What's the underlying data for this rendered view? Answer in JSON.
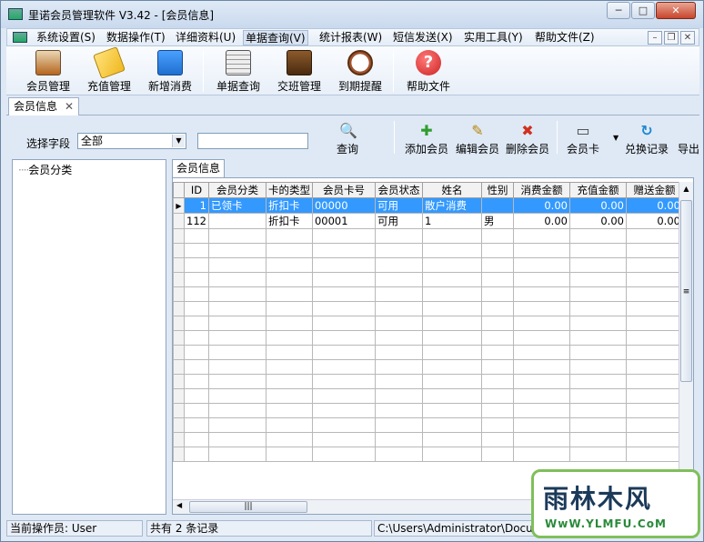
{
  "window": {
    "title": "里诺会员管理软件 V3.42 - [会员信息]",
    "minimize": "─",
    "maximize": "□",
    "close": "✕"
  },
  "menu": {
    "items": [
      "系统设置(S)",
      "数据操作(T)",
      "详细资料(U)",
      "单据查询(V)",
      "统计报表(W)",
      "短信发送(X)",
      "实用工具(Y)",
      "帮助文件(Z)"
    ],
    "mdi_minimize": "–",
    "mdi_restore": "❐",
    "mdi_close": "✕"
  },
  "toolbar": {
    "buttons": [
      {
        "label": "会员管理",
        "color": "#b5651d"
      },
      {
        "label": "充值管理",
        "color": "#f0b820"
      },
      {
        "label": "新增消费",
        "color": "#1e6fd0"
      },
      {
        "label": "单据查询",
        "color": "#7a7a7a"
      },
      {
        "label": "交班管理",
        "color": "#6b3a1a"
      },
      {
        "label": "到期提醒",
        "color": "#a0522d"
      },
      {
        "label": "帮助文件",
        "color": "#cc2222"
      }
    ]
  },
  "tabs": {
    "active": "会员信息",
    "close_glyph": "✕"
  },
  "filter": {
    "label": "选择字段",
    "selected": "全部",
    "search_value": ""
  },
  "actions": [
    {
      "label": "查询",
      "glyph": "🔍",
      "color": "#333333"
    },
    {
      "label": "添加会员",
      "glyph": "✚",
      "color": "#2e9e2e"
    },
    {
      "label": "编辑会员",
      "glyph": "✎",
      "color": "#b8860b"
    },
    {
      "label": "删除会员",
      "glyph": "✖",
      "color": "#d03020"
    },
    {
      "label": "会员卡",
      "glyph": "▭",
      "color": "#444444"
    },
    {
      "label": "兑换记录",
      "glyph": "↻",
      "color": "#1e88d0"
    },
    {
      "label": "导出",
      "glyph": "",
      "color": "#333333"
    }
  ],
  "tree": {
    "root": "会员分类"
  },
  "grid": {
    "tab": "会员信息",
    "columns": [
      "ID",
      "会员分类",
      "卡的类型",
      "会员卡号",
      "会员状态",
      "姓名",
      "性别",
      "消费金额",
      "充值金额",
      "赠送金额"
    ],
    "rows": [
      [
        "1",
        "已领卡",
        "折扣卡",
        "00000",
        "可用",
        "散户消费",
        "",
        "0.00",
        "0.00",
        "0.00"
      ],
      [
        "112",
        "",
        "折扣卡",
        "00001",
        "可用",
        "1",
        "男",
        "0.00",
        "0.00",
        "0.00"
      ]
    ],
    "selected_row": 0
  },
  "status": {
    "operator": "当前操作员: User",
    "count": "共有 2 条记录",
    "path": "C:\\Users\\Administrator\\Docu"
  },
  "watermark": {
    "title": "雨林木风",
    "url": "WwW.YLMFU.CoM"
  }
}
